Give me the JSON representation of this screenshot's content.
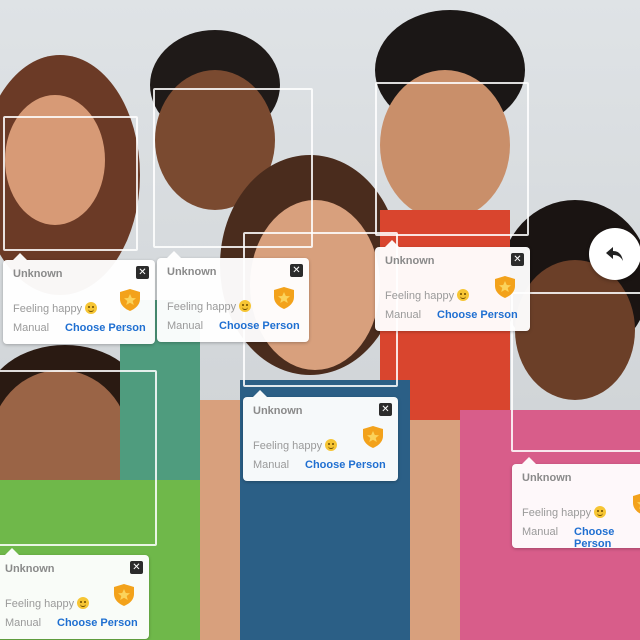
{
  "cards": [
    {
      "name": "Unknown",
      "mood": "Feeling happy",
      "manual": "Manual",
      "choose": "Choose Person",
      "close": "✕"
    },
    {
      "name": "Unknown",
      "mood": "Feeling happy",
      "manual": "Manual",
      "choose": "Choose Person",
      "close": "✕"
    },
    {
      "name": "Unknown",
      "mood": "Feeling happy",
      "manual": "Manual",
      "choose": "Choose Person",
      "close": "✕"
    },
    {
      "name": "Unknown",
      "mood": "Feeling happy",
      "manual": "Manual",
      "choose": "Choose Person",
      "close": "✕"
    },
    {
      "name": "Unknown",
      "mood": "Feeling happy",
      "manual": "Manual",
      "choose": "Choose Person",
      "close": "✕"
    },
    {
      "name": "Unknown",
      "mood": "Feeling happy",
      "manual": "Manual",
      "choose": "Choose Person",
      "close": "✕"
    }
  ],
  "icons": {
    "mood": "smiley-icon",
    "badge": "shield-star-icon",
    "close": "close-icon",
    "back": "undo-arrow-icon"
  },
  "colors": {
    "link": "#1f6fd1",
    "badge": "#f3a21b",
    "card_bg": "#ffffff"
  }
}
